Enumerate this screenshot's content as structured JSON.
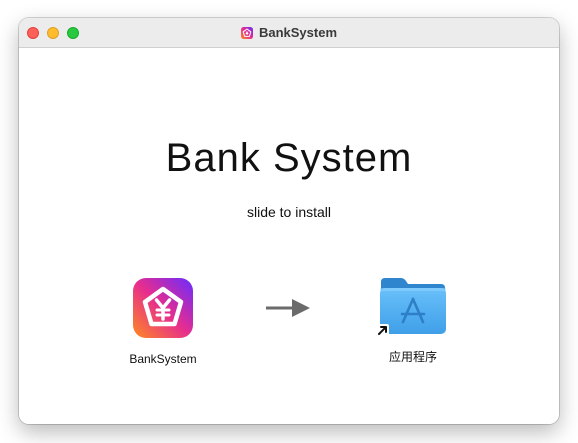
{
  "window": {
    "title": "BankSystem",
    "title_icon": "banksystem-app-icon"
  },
  "installer": {
    "heading": "Bank System",
    "subheading": "slide to install",
    "app_label": "BankSystem",
    "app_icon": "yen-pentagon-icon",
    "arrow_icon": "right-arrow-icon",
    "folder_label": "应用程序",
    "folder_icon": "applications-folder-icon"
  },
  "colors": {
    "traffic_close": "#fe5f57",
    "traffic_minimize": "#febc2e",
    "traffic_zoom": "#28c840",
    "folder_blue": "#5eb5f4",
    "app_gradient_start": "#ff8a1f",
    "app_gradient_mid": "#e62d8f",
    "app_gradient_end": "#6a2bff"
  }
}
